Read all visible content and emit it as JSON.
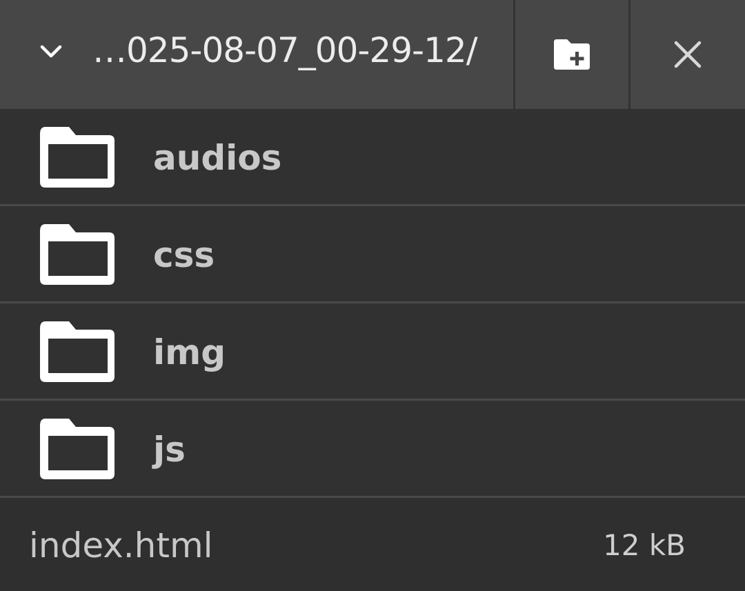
{
  "header": {
    "path": "…025-08-07_00-29-12/",
    "chevron_icon": "chevron-down-icon",
    "new_folder_icon": "new-folder-icon",
    "close_icon": "close-icon"
  },
  "folders": [
    {
      "label": "audios",
      "icon": "folder-icon"
    },
    {
      "label": "css",
      "icon": "folder-icon"
    },
    {
      "label": "img",
      "icon": "folder-icon"
    },
    {
      "label": "js",
      "icon": "folder-icon"
    }
  ],
  "files": [
    {
      "label": "index.html",
      "size": "12 kB"
    }
  ],
  "colors": {
    "header_bg": "#474747",
    "list_bg": "#313131",
    "divider": "#4a4a4a",
    "text": "#c8c8c8",
    "icon": "#ffffff"
  }
}
